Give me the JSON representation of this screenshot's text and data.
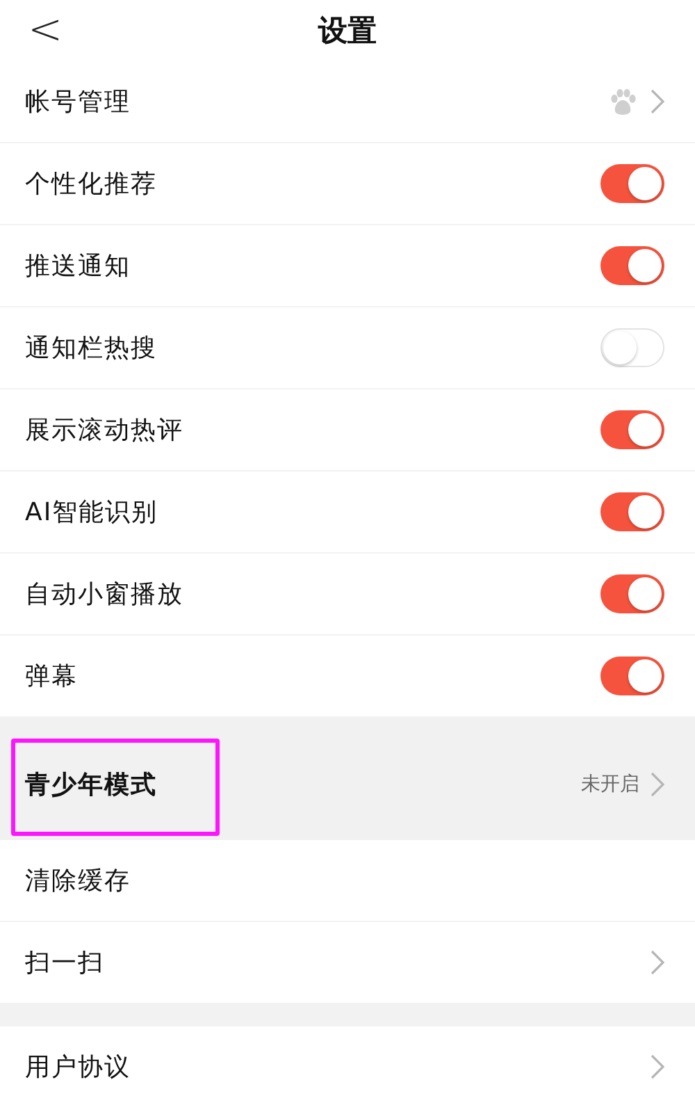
{
  "header": {
    "back": "<",
    "title": "设置"
  },
  "groups": [
    {
      "items": [
        {
          "kind": "account",
          "label": "帐号管理"
        },
        {
          "kind": "toggle",
          "label": "个性化推荐",
          "on": true
        },
        {
          "kind": "toggle",
          "label": "推送通知",
          "on": true
        },
        {
          "kind": "toggle",
          "label": "通知栏热搜",
          "on": false
        },
        {
          "kind": "toggle",
          "label": "展示滚动热评",
          "on": true
        },
        {
          "kind": "toggle",
          "label": "AI智能识别",
          "on": true
        },
        {
          "kind": "toggle",
          "label": "自动小窗播放",
          "on": true
        },
        {
          "kind": "toggle",
          "label": "弹幕",
          "on": true
        }
      ]
    },
    {
      "items": [
        {
          "kind": "link",
          "label": "青少年模式",
          "value": "未开启",
          "highlighted": true
        },
        {
          "kind": "plain",
          "label": "清除缓存"
        },
        {
          "kind": "link",
          "label": "扫一扫"
        }
      ]
    },
    {
      "items": [
        {
          "kind": "link",
          "label": "用户协议"
        }
      ]
    }
  ]
}
